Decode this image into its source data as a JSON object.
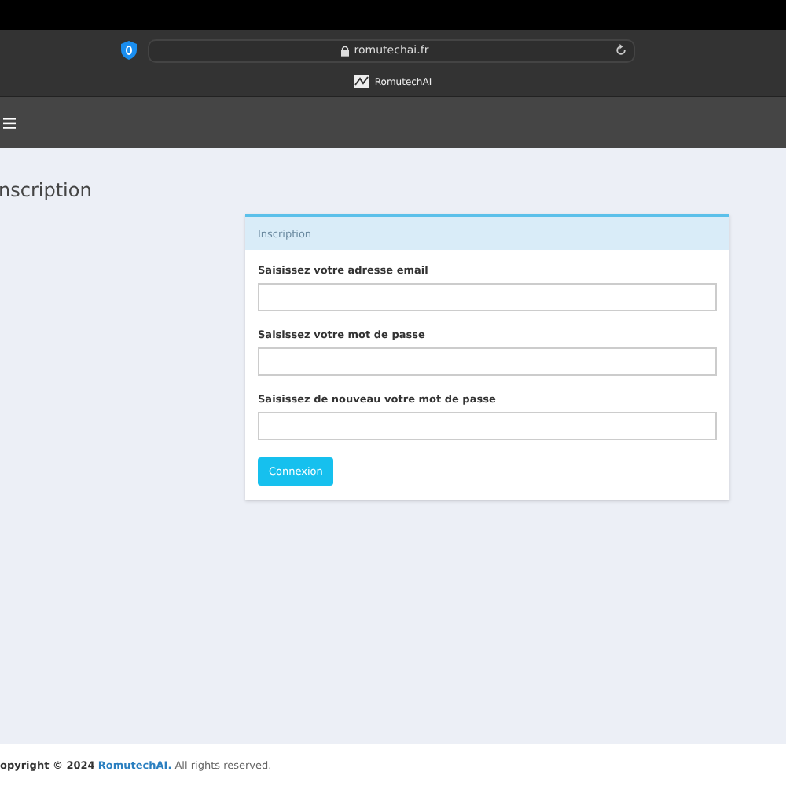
{
  "browser": {
    "url": "romutechai.fr",
    "tab_title": "RomutechAI"
  },
  "page_title": "nscription",
  "card": {
    "header": "Inscription",
    "fields": [
      {
        "label": "Saisissez votre adresse email"
      },
      {
        "label": "Saisissez votre mot de passe"
      },
      {
        "label": "Saisissez de nouveau votre mot de passe"
      }
    ],
    "button": "Connexion"
  },
  "footer": {
    "text_before": "**opyright © 2024**",
    "link": "RomutechAI.",
    "text_after": "All rights reserved."
  }
}
